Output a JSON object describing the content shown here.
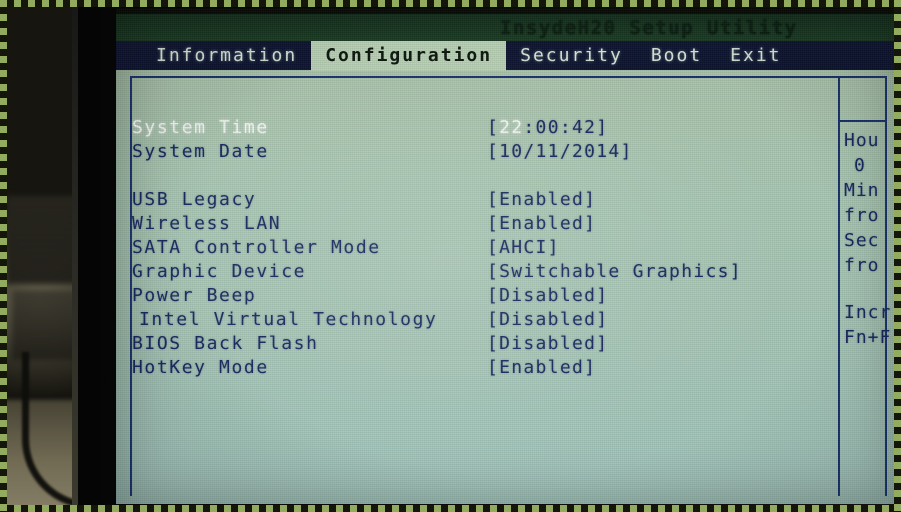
{
  "photo": {
    "description": "photograph of a laptop screen showing the InsydeH20 BIOS Setup Utility, Configuration tab"
  },
  "bios": {
    "title": "InsydeH20 Setup Utility",
    "menu": [
      {
        "label": "Information",
        "active": false
      },
      {
        "label": "Configuration",
        "active": true
      },
      {
        "label": "Security",
        "active": false
      },
      {
        "label": "Boot",
        "active": false
      },
      {
        "label": "Exit",
        "active": false
      }
    ],
    "rows": [
      {
        "label": "System Time",
        "value_prefix": "[",
        "value_highlight": "22",
        "value_suffix": ":00:42]",
        "selected": true,
        "indent": false
      },
      {
        "label": "System Date",
        "value": "[10/11/2014]",
        "selected": false,
        "indent": false
      },
      {
        "label": "USB Legacy",
        "value": "[Enabled]",
        "selected": false,
        "indent": false
      },
      {
        "label": "Wireless LAN",
        "value": "[Enabled]",
        "selected": false,
        "indent": false
      },
      {
        "label": "SATA Controller Mode",
        "value": "[AHCI]",
        "selected": false,
        "indent": false
      },
      {
        "label": "Graphic Device",
        "value": "[Switchable Graphics]",
        "selected": false,
        "indent": false
      },
      {
        "label": "Power Beep",
        "value": "[Disabled]",
        "selected": false,
        "indent": false
      },
      {
        "label": "Intel Virtual Technology",
        "value": "[Disabled]",
        "selected": false,
        "indent": true
      },
      {
        "label": "BIOS Back Flash",
        "value": "[Disabled]",
        "selected": false,
        "indent": false
      },
      {
        "label": "HotKey Mode",
        "value": "[Enabled]",
        "selected": false,
        "indent": false
      }
    ],
    "help_lines": [
      "Hou",
      "0",
      "Min",
      "fro",
      "Sec",
      "fro",
      "",
      "Incr",
      "Fn+F"
    ]
  },
  "colors": {
    "screen_green": "#a9c7b2",
    "menu_navy": "#0d1430",
    "text_navy": "#16255f",
    "active_tab_bg": "#b7cfb3",
    "frame_border": "#17306c",
    "ants_green": "#93ab5e"
  }
}
